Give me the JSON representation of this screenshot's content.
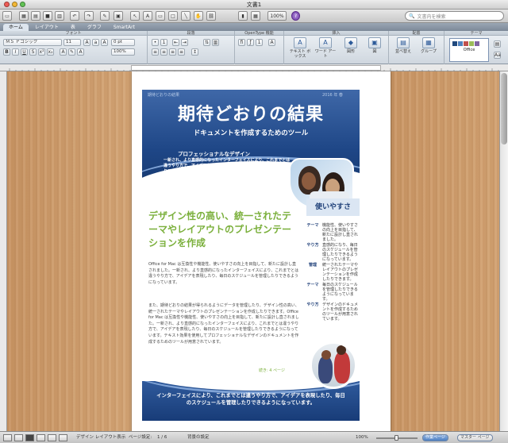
{
  "window": {
    "title": "文書1"
  },
  "toolbar": {
    "zoom": "100%",
    "search_placeholder": "文書内を検索"
  },
  "ribbon": {
    "tabs": [
      {
        "label": "ホーム",
        "active": true
      },
      {
        "label": "レイアウト",
        "active": false
      },
      {
        "label": "表",
        "active": false
      },
      {
        "label": "グラフ",
        "active": false
      },
      {
        "label": "SmartArt",
        "active": false
      }
    ],
    "groups": {
      "font": "フォント",
      "paragraph": "段落",
      "opentype": "OpenType 機能",
      "insert": "挿入",
      "arrange": "配置",
      "theme": "テーマ"
    },
    "font_name": "ＭＳ Ｐゴシック",
    "font_size": "11",
    "line_spacing": "0 pt",
    "char_scale": "100%",
    "buttons": {
      "textbox": "テキスト ボックス",
      "wordart": "ワード アート",
      "shape": "図形",
      "picture": "図",
      "wrap": "並べ替え",
      "group": "グループ",
      "theme": "Office"
    }
  },
  "document": {
    "meta_left": "期待どおりの結果",
    "meta_right": "2016 年 春",
    "title": "期待どおりの結果",
    "subtitle": "ドキュメントを作成するためのツール",
    "pro_heading": "プロフェッショナルなデザイン",
    "pro_body": "一新され、より直感的になったインターフェイスにより、これまでとは違うやり方で、アイデアを表現したり、毎日のスケジュールを管理したりできるようになっています。",
    "page_ref": "3 ページ",
    "left_heading": "デザイン性の高い、統一されたテーマやレイアウトのプレゼンテーションを作成",
    "body1": "Office for Mac は互換性や機能性、使いやすさの向上を目指して、新たに設計し直されました。一新され、より直感的になったインターフェイスにより、これまでとは違うやり方で、アイデアを表現したり、毎日のスケジュールを管理したりできるようになっています。",
    "body2": "また、期待どおりの結果が得られるようにデータを管理したり、デザイン性の高い、統一されたテーマやレイアウトのプレゼンテーションを作成したりできます。Office for Mac は互換性や機能性、使いやすさの向上を目指して、新たに設計し直されました。一新され、より直感的になったインターフェイスにより、これまでとは違うやり方で、アイデアを表現したり、毎日のスケジュールを管理したりできるようになっています。テキスト効果を使用してプロフェッショナルなデザインのドキュメントを作成するためのツールが用意されています。",
    "continued": "続き: 4 ページ",
    "sidebar": {
      "heading": "使いやすさ",
      "rows": [
        {
          "key": "テーマ",
          "value": "機能性、使いやすさの向上を目指して、新たに設計し直されました。"
        },
        {
          "key": "やり方",
          "value": "直感的になり、毎日のスケジュールを管理したりできるようになっています。"
        },
        {
          "key": "管理",
          "value": "統一されたテーマやレイアウトのプレゼンテーションを作成したりできます。"
        },
        {
          "key": "テーマ",
          "value": "毎日のスケジュールを管理したりできるようになっています。"
        },
        {
          "key": "やり方",
          "value": "デザインのドキュメントを作成するためのツールが用意されています。"
        }
      ]
    },
    "footer_text": "インターフェイスにより、これまでとは違うやり方で、アイデアを表現したり、毎日のスケジュールを管理したりできるようになっています。"
  },
  "status": {
    "view": "デザイン レイアウト表示",
    "page_label": "ページ設定:",
    "page_count": "1 / 6",
    "background": "背景の設定",
    "zoom": "100%",
    "btn_body": "作業ページ",
    "btn_master": "マスター ページ"
  }
}
